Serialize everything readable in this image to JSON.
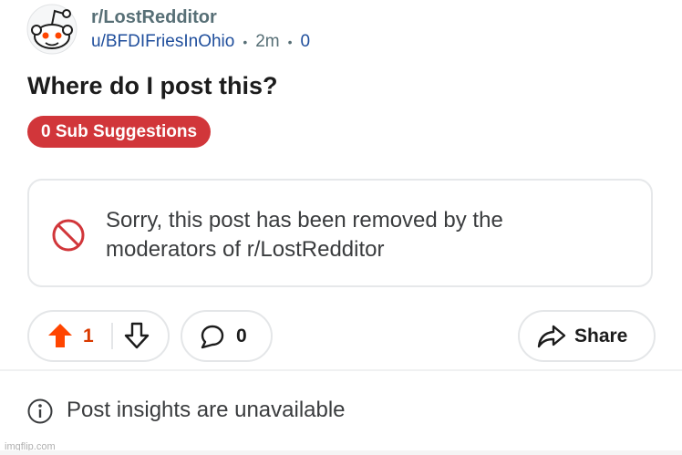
{
  "post": {
    "subreddit": "r/LostRedditor",
    "author": "u/BFDIFriesInOhio",
    "separator": "•",
    "age": "2m",
    "meta_count": "0",
    "title": "Where do I post this?",
    "flair": "0 Sub Suggestions",
    "removed_message": "Sorry, this post has been removed by the moderators of r/LostRedditor"
  },
  "actions": {
    "vote_count": "1",
    "comment_count": "0",
    "share_label": "Share"
  },
  "insights": {
    "text": "Post insights are unavailable"
  },
  "watermark": "imgflip.com",
  "colors": {
    "upvote": "#ff4500",
    "flair_bg": "#d1363a",
    "ban": "#d1363a",
    "link": "#1f4e9c"
  },
  "icons": [
    "snoo-avatar-icon",
    "ban-icon",
    "upvote-arrow-icon",
    "downvote-arrow-icon",
    "comment-bubble-icon",
    "share-arrow-icon",
    "info-icon"
  ]
}
